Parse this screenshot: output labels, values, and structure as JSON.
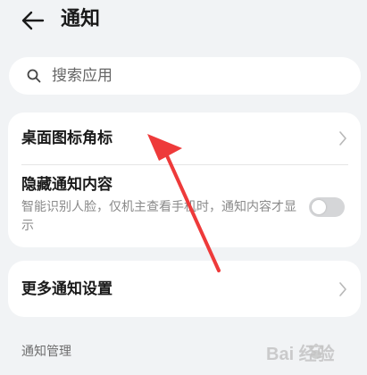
{
  "header": {
    "title": "通知",
    "back_icon": "back-arrow-icon"
  },
  "search": {
    "placeholder": "搜索应用",
    "icon": "search-icon"
  },
  "card1": {
    "badge_row": {
      "label": "桌面图标角标",
      "icon": "chevron-right-icon"
    },
    "hide_row": {
      "label": "隐藏通知内容",
      "description": "智能识别人脸，仅机主查看手机时，通知内容才显示",
      "toggle_on": false
    }
  },
  "card2": {
    "more_row": {
      "label": "更多通知设置",
      "icon": "chevron-right-icon"
    }
  },
  "section": {
    "title": "通知管理"
  },
  "colors": {
    "background": "#f1f3f5",
    "card": "#ffffff",
    "annotation_arrow": "#ee3a3a",
    "toggle_off": "#d5d6d8"
  },
  "watermark": {
    "text": "Bai 经验"
  }
}
